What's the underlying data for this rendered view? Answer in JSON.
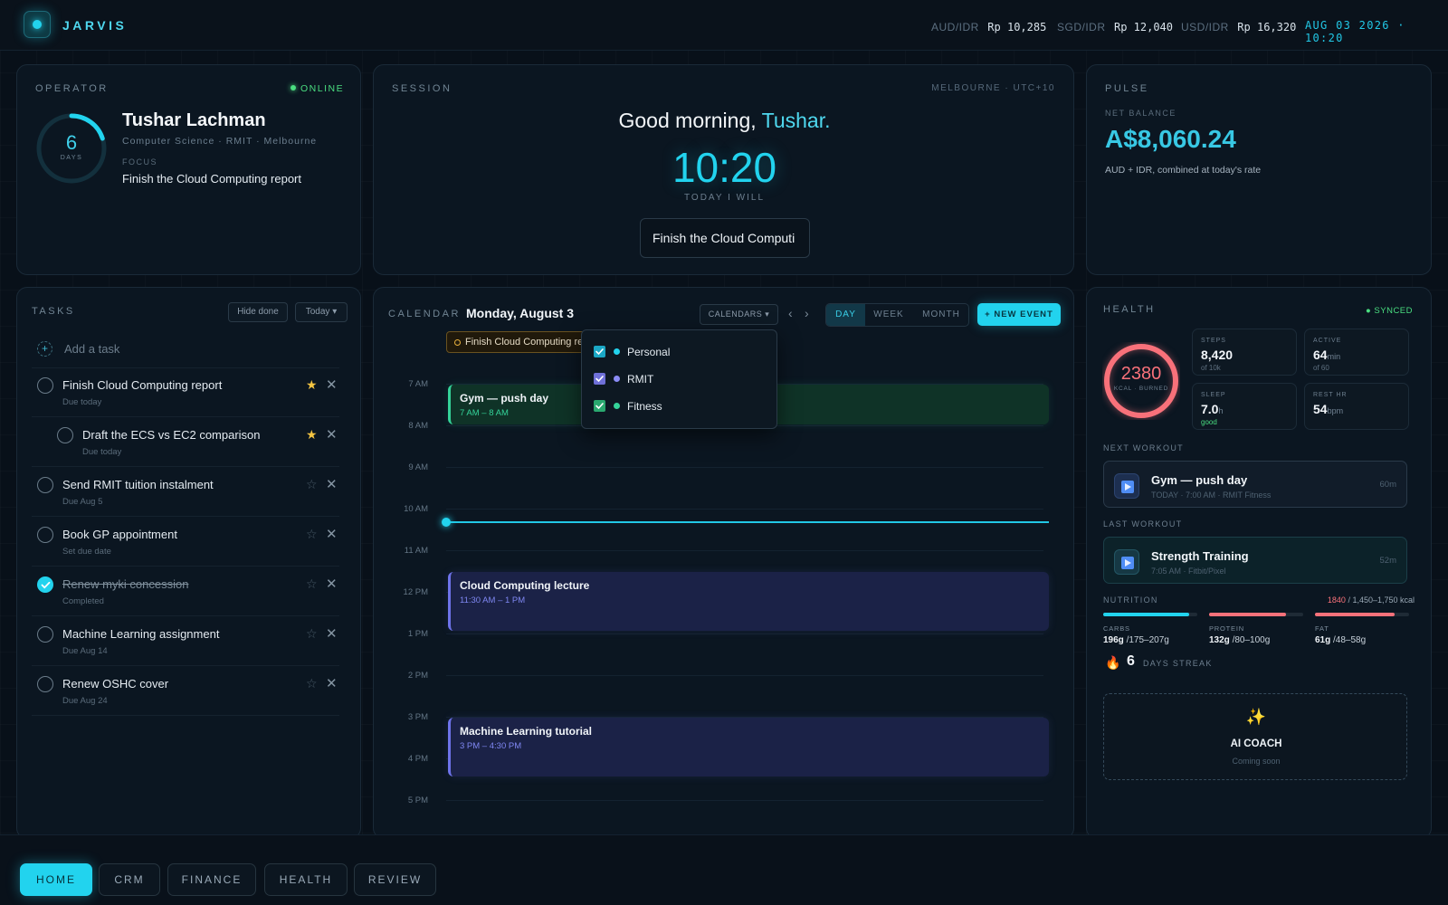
{
  "app": {
    "name": "JARVIS",
    "datetime": "AUG 03 2026 · 10:20"
  },
  "rates": [
    {
      "label": "AUD/IDR",
      "value": "Rp 10,285"
    },
    {
      "label": "SGD/IDR",
      "value": "Rp 12,040"
    },
    {
      "label": "USD/IDR",
      "value": "Rp 16,320"
    }
  ],
  "operator": {
    "title": "OPERATOR",
    "status": "ONLINE",
    "days_num": "6",
    "days_lbl": "DAYS",
    "name": "Tushar Lachman",
    "sub": "Computer Science · RMIT · Melbourne",
    "focus_lbl": "FOCUS",
    "focus": "Finish the Cloud Computing report",
    "ring_progress": 0.2
  },
  "session": {
    "title": "SESSION",
    "location": "MELBOURNE · UTC+10",
    "greeting_pre": "Good morning, ",
    "greeting_name": "Tushar.",
    "time": "10:20",
    "today_will": "TODAY I WILL",
    "input_value": "Finish the Cloud Computi"
  },
  "pulse": {
    "title": "PULSE",
    "net_lbl": "NET BALANCE",
    "balance": "A$8,060.24",
    "note": "AUD + IDR, combined at today's rate"
  },
  "tasks": {
    "title": "TASKS",
    "hide_done": "Hide done",
    "filter": "Today ▾",
    "add_placeholder": "Add a task",
    "items": [
      {
        "title": "Finish Cloud Computing report",
        "due": "Due today",
        "starred": true,
        "done": false,
        "indent": false
      },
      {
        "title": "Draft the ECS vs EC2 comparison",
        "due": "Due today",
        "starred": true,
        "done": false,
        "indent": true
      },
      {
        "title": "Send RMIT tuition instalment",
        "due": "Due Aug 5",
        "starred": false,
        "done": false,
        "indent": false
      },
      {
        "title": "Book GP appointment",
        "due": "Set due date",
        "starred": false,
        "done": false,
        "indent": false
      },
      {
        "title": "Renew myki concession",
        "due": "Completed",
        "starred": false,
        "done": true,
        "indent": false
      },
      {
        "title": "Machine Learning assignment",
        "due": "Due Aug 14",
        "starred": false,
        "done": false,
        "indent": false
      },
      {
        "title": "Renew OSHC cover",
        "due": "Due Aug 24",
        "starred": false,
        "done": false,
        "indent": false
      }
    ],
    "star_filled": "★",
    "star_empty": "☆",
    "close": "✕"
  },
  "calendar": {
    "title": "CALENDAR",
    "date": "Monday, August 3",
    "calendars_btn": "CALENDARS ▾",
    "prev": "‹",
    "next": "›",
    "views": [
      "DAY",
      "WEEK",
      "MONTH"
    ],
    "active_view": "DAY",
    "new_event": "+ NEW EVENT",
    "allday_event": "Finish Cloud Computing report",
    "hours": [
      "7 AM",
      "8 AM",
      "9 AM",
      "10 AM",
      "11 AM",
      "12 PM",
      "1 PM",
      "2 PM",
      "3 PM",
      "4 PM",
      "5 PM"
    ],
    "now_hour": 10.33,
    "events": [
      {
        "title": "Gym — push day",
        "time": "7 AM – 8 AM",
        "start": 7,
        "end": 8,
        "kind": "fitness"
      },
      {
        "title": "Cloud Computing lecture",
        "time": "11:30 AM – 1 PM",
        "start": 11.5,
        "end": 12.95,
        "kind": "rmit"
      },
      {
        "title": "Machine Learning tutorial",
        "time": "3 PM – 4:30 PM",
        "start": 15,
        "end": 16.45,
        "kind": "rmit"
      }
    ],
    "dropdown": [
      {
        "label": "Personal",
        "color": "#22d3ee"
      },
      {
        "label": "RMIT",
        "color": "#8b8cf6"
      },
      {
        "label": "Fitness",
        "color": "#34d399"
      }
    ]
  },
  "health": {
    "title": "HEALTH",
    "synced": "● SYNCED",
    "kcal": "2380",
    "kcal_lbl": "KCAL · BURNED",
    "stats": {
      "steps": {
        "lbl": "STEPS",
        "val": "8,420",
        "sub": "of 10k"
      },
      "active": {
        "lbl": "ACTIVE",
        "val": "64",
        "unit": "min",
        "sub": "of 60"
      },
      "sleep": {
        "lbl": "SLEEP",
        "val": "7.0",
        "unit": "h",
        "sub": "good"
      },
      "resthr": {
        "lbl": "REST HR",
        "val": "54",
        "unit": "bpm"
      }
    },
    "next_lbl": "NEXT WORKOUT",
    "next": {
      "title": "Gym — push day",
      "sub": "TODAY · 7:00 AM · RMIT Fitness",
      "dur": "60m"
    },
    "last_lbl": "LAST WORKOUT",
    "last": {
      "title": "Strength Training",
      "sub": "7:05 AM · Fitbit/Pixel",
      "dur": "52m"
    },
    "nutrition_lbl": "NUTRITION",
    "nutrition_kcal": "1840",
    "nutrition_target": " / 1,450–1,750 kcal",
    "macros": [
      {
        "lbl": "CARBS",
        "val": "196g",
        "target": " /175–207g",
        "color": "#22d3ee",
        "fill": 0.91
      },
      {
        "lbl": "PROTEIN",
        "val": "132g",
        "target": " /80–100g",
        "color": "#f8717a",
        "fill": 0.82
      },
      {
        "lbl": "FAT",
        "val": "61g",
        "target": " /48–58g",
        "color": "#f8717a",
        "fill": 0.85
      }
    ],
    "streak_num": "6",
    "streak_lbl": "DAYS STREAK",
    "coach_title": "AI COACH",
    "coach_sub": "Coming soon"
  },
  "nav": [
    "HOME",
    "CRM",
    "FINANCE",
    "HEALTH",
    "REVIEW"
  ],
  "nav_active": "HOME"
}
